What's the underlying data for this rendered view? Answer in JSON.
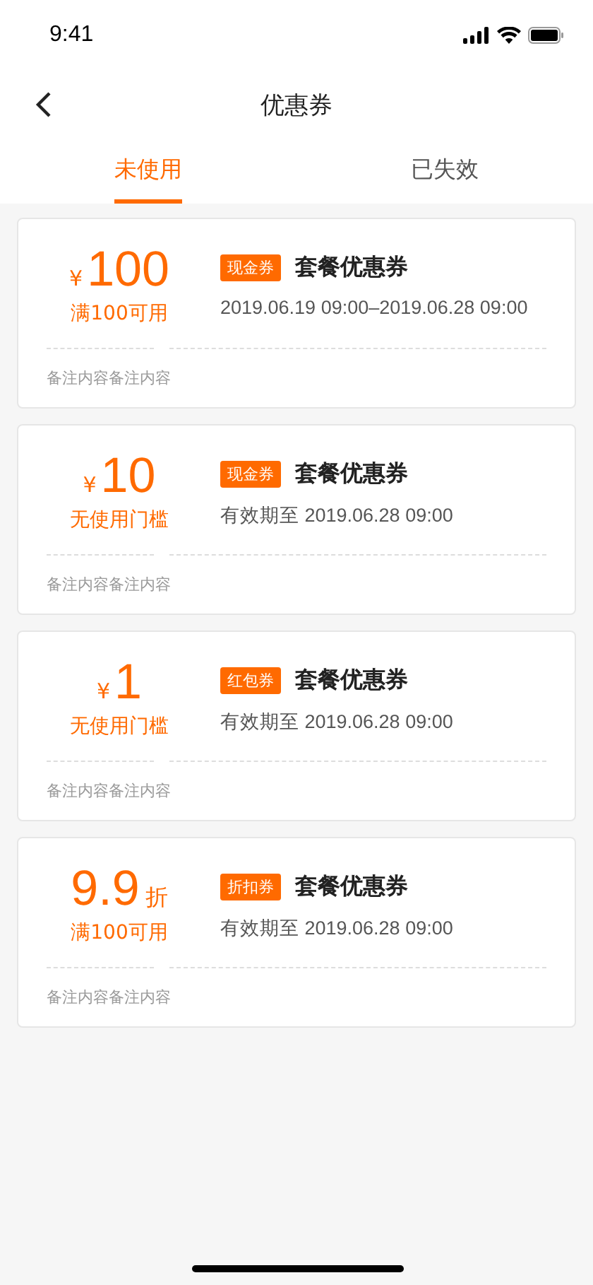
{
  "status_bar": {
    "time": "9:41"
  },
  "nav": {
    "title": "优惠券"
  },
  "tabs": [
    {
      "label": "未使用",
      "selected": true
    },
    {
      "label": "已失效",
      "selected": false
    }
  ],
  "coupons": [
    {
      "prefix": "¥",
      "amount": "100",
      "condition": "满100可用",
      "tag": "现金券",
      "name": "套餐优惠券",
      "validity": "2019.06.19 09:00–2019.06.28 09:00",
      "note": "备注内容备注内容"
    },
    {
      "prefix": "¥",
      "amount": "10",
      "condition": "无使用门槛",
      "tag": "现金券",
      "name": "套餐优惠券",
      "validity": "有效期至  2019.06.28 09:00",
      "note": "备注内容备注内容"
    },
    {
      "prefix": "¥",
      "amount": "1",
      "condition": "无使用门槛",
      "tag": "红包券",
      "name": "套餐优惠券",
      "validity": "有效期至  2019.06.28 09:00",
      "note": "备注内容备注内容"
    },
    {
      "suffix": "折",
      "amount": "9.9",
      "condition": "满100可用",
      "tag": "折扣券",
      "name": "套餐优惠券",
      "validity": "有效期至  2019.06.28 09:00",
      "note": "备注内容备注内容"
    }
  ]
}
